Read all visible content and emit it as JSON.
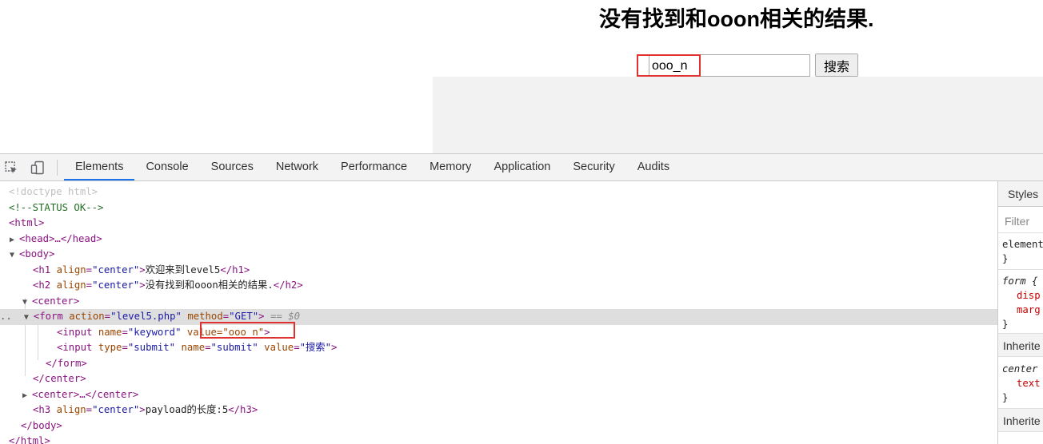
{
  "page": {
    "heading": "没有找到和ooon相关的结果.",
    "keyword_value": "ooo_n",
    "submit_label": "搜索"
  },
  "devtools": {
    "tabs": [
      "Elements",
      "Console",
      "Sources",
      "Network",
      "Performance",
      "Memory",
      "Application",
      "Security",
      "Audits"
    ],
    "active_tab": "Elements",
    "dom": {
      "doctype": "<!doctype html>",
      "comment": "<!--STATUS OK-->",
      "html_open": "<html>",
      "head_collapsed": "<head>…</head>",
      "body_open": "<body>",
      "h1_text": "欢迎来到level5",
      "h2_text": "没有找到和ooon相关的结果.",
      "form_action": "\"level5.php\"",
      "form_method": "\"GET\"",
      "selected_suffix": "== $0",
      "input_name": "\"keyword\"",
      "input_value": "value=\"ooo_n\"",
      "submit_type": "\"submit\"",
      "submit_name": "\"submit\"",
      "submit_value": "\"搜索\"",
      "center_collapsed": "<center>…</center>",
      "h3_text": "payload的长度:5",
      "body_close": "</body>",
      "html_close": "</html>"
    },
    "styles": {
      "tab_label": "Styles",
      "filter_placeholder": "Filter",
      "rule1_selector": "element",
      "rule2_selector": "form {",
      "rule2_prop1": "disp",
      "rule2_prop2": "marg",
      "inherited_label": "Inherite",
      "rule3_selector": "center",
      "rule3_prop1": "text",
      "close_brace": "}"
    }
  }
}
